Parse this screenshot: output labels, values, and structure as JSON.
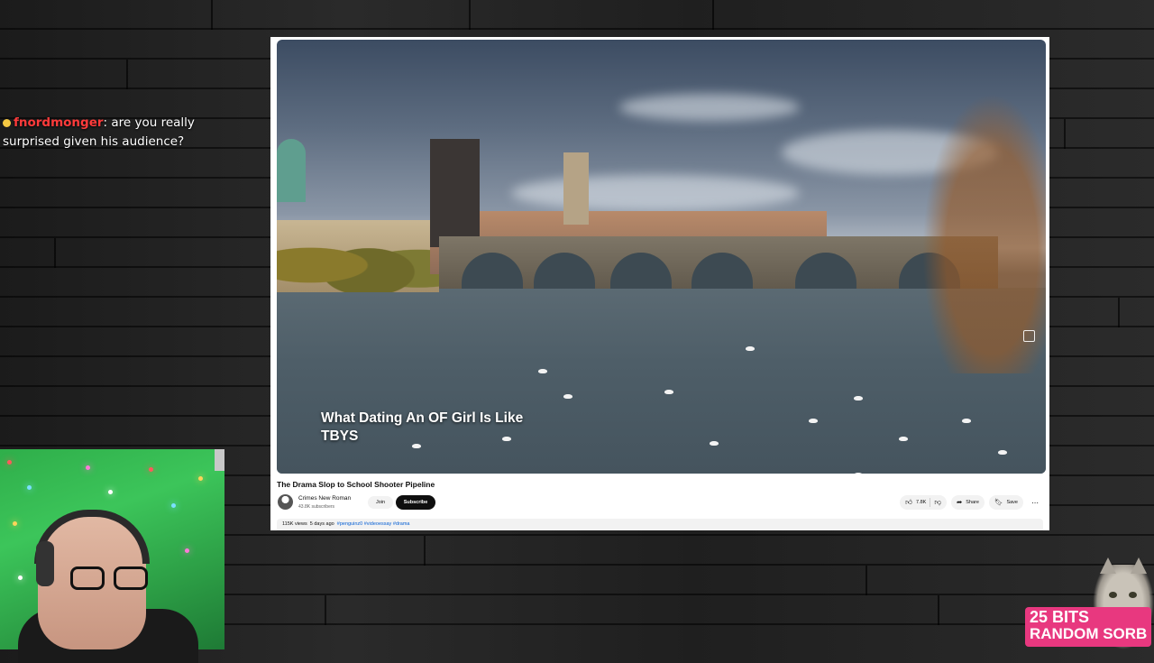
{
  "chat": {
    "username": "fnordmonger",
    "separator": ":",
    "message": " are you really surprised given his audience?"
  },
  "video": {
    "caption_line1": "What Dating An OF Girl Is Like",
    "caption_line2": "TBYS",
    "title": "The Drama Slop to School Shooter Pipeline",
    "channel_name": "Crimes New Roman",
    "channel_subs": "43.8K subscribers",
    "join_label": "Join",
    "subscribe_label": "Subscribe",
    "like_count": "7.8K",
    "share_label": "Share",
    "save_label": "Save",
    "views": "115K views",
    "age": "5 days ago",
    "tags": "#penguinz0 #videoessay #drama"
  },
  "overlay": {
    "bits_line1": "25 BITS",
    "bits_line2": "RANDOM SORB"
  },
  "colors": {
    "chat_username": "#ff3b3b",
    "bits_bg": "#e8387f",
    "webcam_bg": "#3cc55a"
  }
}
